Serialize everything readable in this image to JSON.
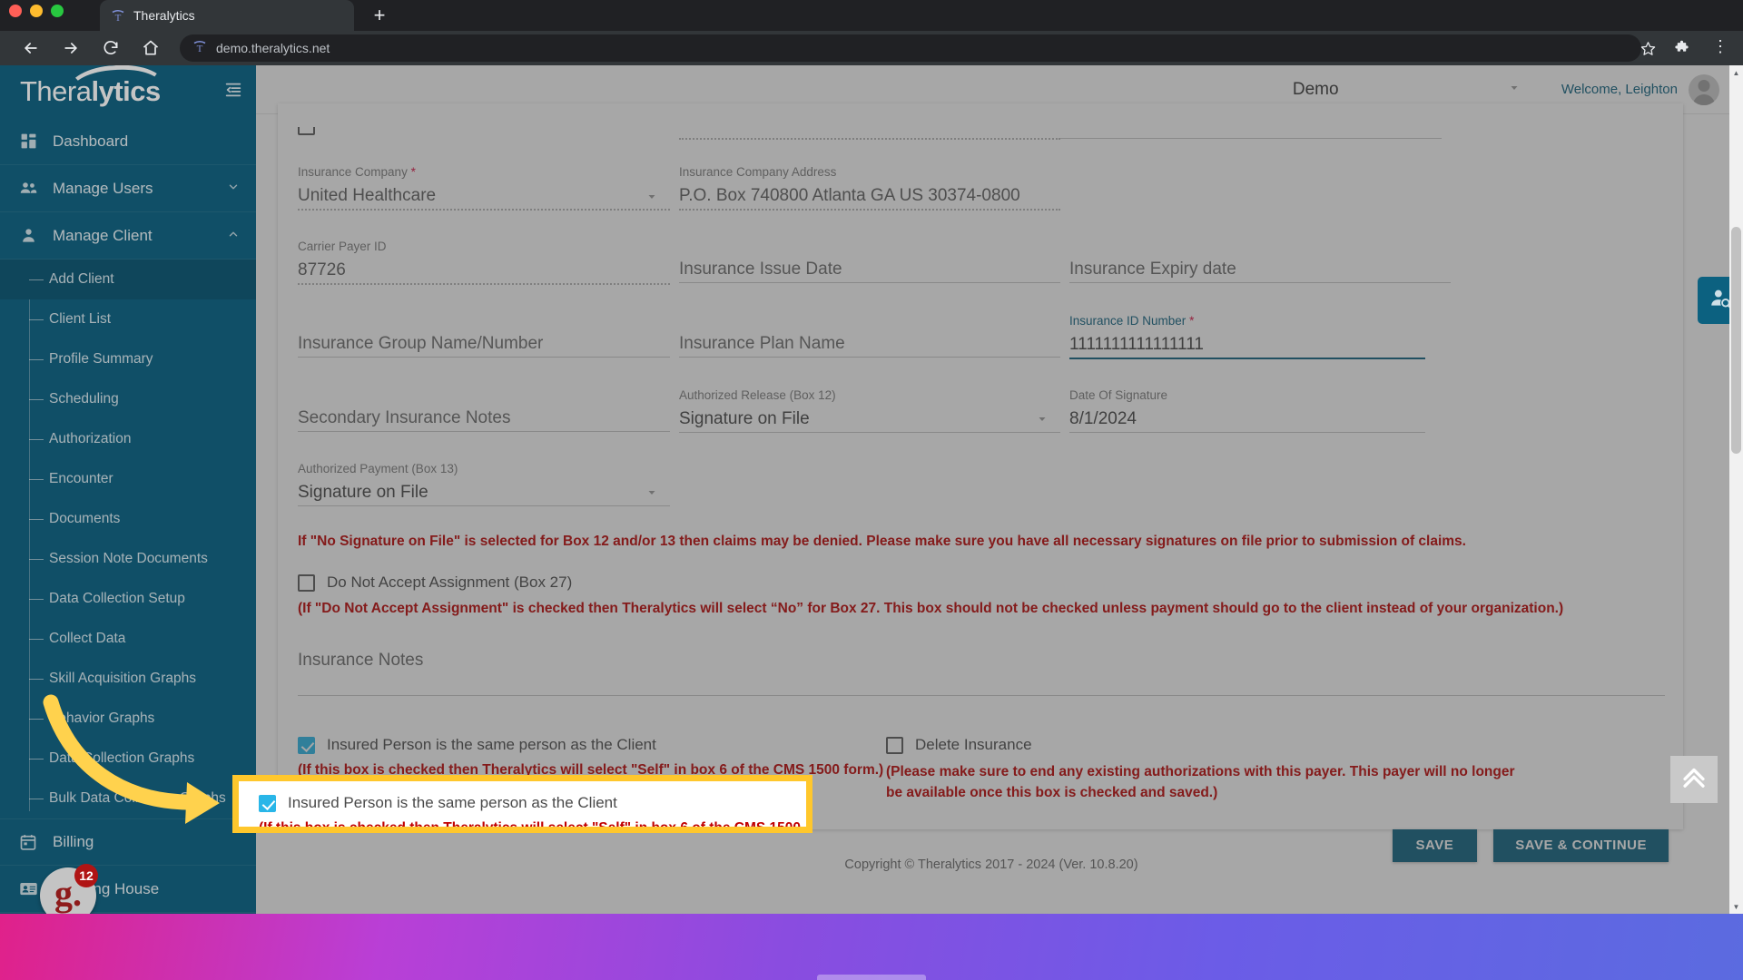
{
  "browser": {
    "tab_title": "Theralytics",
    "new_tab_label": "+",
    "url": "demo.theralytics.net",
    "back_icon": "back-arrow-icon",
    "forward_icon": "forward-arrow-icon",
    "reload_icon": "reload-icon",
    "home_icon": "home-icon",
    "bookmark_icon": "star-icon",
    "extensions_icon": "puzzle-piece-icon",
    "menu_icon": "kebab-menu-icon"
  },
  "sidebar": {
    "brand": "Thera",
    "brand_bold": "lytics",
    "collapse_icon": "collapse-sidebar-icon",
    "items": [
      {
        "label": "Dashboard",
        "icon": "dashboard-icon",
        "chevron": "",
        "expanded": false
      },
      {
        "label": "Manage Users",
        "icon": "users-icon",
        "chevron": "⌄",
        "expanded": false
      },
      {
        "label": "Manage Client",
        "icon": "person-icon",
        "chevron": "⌃",
        "expanded": true
      }
    ],
    "sub_items": [
      {
        "label": "Add Client",
        "active": true
      },
      {
        "label": "Client List",
        "active": false
      },
      {
        "label": "Profile Summary",
        "active": false
      },
      {
        "label": "Scheduling",
        "active": false
      },
      {
        "label": "Authorization",
        "active": false
      },
      {
        "label": "Encounter",
        "active": false
      },
      {
        "label": "Documents",
        "active": false
      },
      {
        "label": "Session Note Documents",
        "active": false
      },
      {
        "label": "Data Collection Setup",
        "active": false
      },
      {
        "label": "Collect Data",
        "active": false
      },
      {
        "label": "Skill Acquisition Graphs",
        "active": false
      },
      {
        "label": "Behavior Graphs",
        "active": false
      },
      {
        "label": "Data Collection Graphs",
        "active": false
      },
      {
        "label": "Bulk Data Collection Graphs",
        "active": false
      }
    ],
    "bottom_items": [
      {
        "label": "Billing",
        "icon": "calendar-icon"
      },
      {
        "label": "Clearing House",
        "icon": "id-card-icon"
      }
    ],
    "notification_badge": {
      "glyph": "g.",
      "count": "12"
    }
  },
  "topbar": {
    "org_value": "Demo",
    "org_caret_icon": "chevron-down-icon",
    "welcome": "Welcome, Leighton",
    "avatar_icon": "user-avatar-icon"
  },
  "form": {
    "insurance_company": {
      "label": "Insurance Company",
      "required": "*",
      "value": "United Healthcare"
    },
    "insurance_company_address": {
      "label": "Insurance Company Address",
      "value": "P.O. Box 740800 Atlanta GA US 30374-0800"
    },
    "carrier_payer_id": {
      "label": "Carrier Payer ID",
      "value": "87726"
    },
    "insurance_issue_date": {
      "placeholder": "Insurance Issue Date",
      "value": ""
    },
    "insurance_expiry_date": {
      "placeholder": "Insurance Expiry date",
      "value": ""
    },
    "insurance_group": {
      "placeholder": "Insurance Group Name/Number",
      "value": ""
    },
    "insurance_plan_name": {
      "placeholder": "Insurance Plan Name",
      "value": ""
    },
    "insurance_id_number": {
      "label": "Insurance ID Number",
      "required": "*",
      "value": "1111111111111111",
      "focused": true
    },
    "secondary_insurance_notes": {
      "placeholder": "Secondary Insurance Notes",
      "value": ""
    },
    "authorized_release": {
      "label": "Authorized Release (Box 12)",
      "value": "Signature on File"
    },
    "date_of_signature": {
      "label": "Date Of Signature",
      "value": "8/1/2024"
    },
    "authorized_payment": {
      "label": "Authorized Payment (Box 13)",
      "value": "Signature on File"
    },
    "signature_warning": "If \"No Signature on File\" is selected for Box 12 and/or 13 then claims may be denied. Please make sure you have all necessary signatures on file prior to submission of claims.",
    "do_not_accept_assignment": {
      "label": "Do Not Accept Assignment (Box 27)",
      "checked": false
    },
    "assignment_warning": "(If \"Do Not Accept Assignment\" is checked then Theralytics will select “No” for Box 27. This box should not be checked unless payment should go to the client instead of your organization.)",
    "insurance_notes": {
      "placeholder": "Insurance Notes",
      "value": ""
    },
    "insured_same_as_client": {
      "label": "Insured Person is the same person as the Client",
      "checked": true
    },
    "insured_same_note": "(If this box is checked then Theralytics will select \"Self\" in box 6 of the CMS 1500 form.)",
    "delete_insurance": {
      "label": "Delete Insurance",
      "checked": false
    },
    "delete_insurance_note_line1": "(Please make sure to end any existing authorizations with this payer. This payer will no longer",
    "delete_insurance_note_line2": "be available once this box is checked and saved.)",
    "save_label": "SAVE",
    "save_continue_label": "SAVE & CONTINUE"
  },
  "right_tabs": {
    "person_search_icon": "person-search-icon",
    "scroll_top_icon": "scroll-to-top-icon"
  },
  "footer": {
    "copyright": "Copyright © Theralytics 2017 - 2024 (Ver. 10.8.20)"
  },
  "colors": {
    "brand_teal": "#0c6180",
    "highlight_yellow": "#ffc72c",
    "warning_red": "#c00000",
    "checkbox_blue": "#29b6e8"
  }
}
